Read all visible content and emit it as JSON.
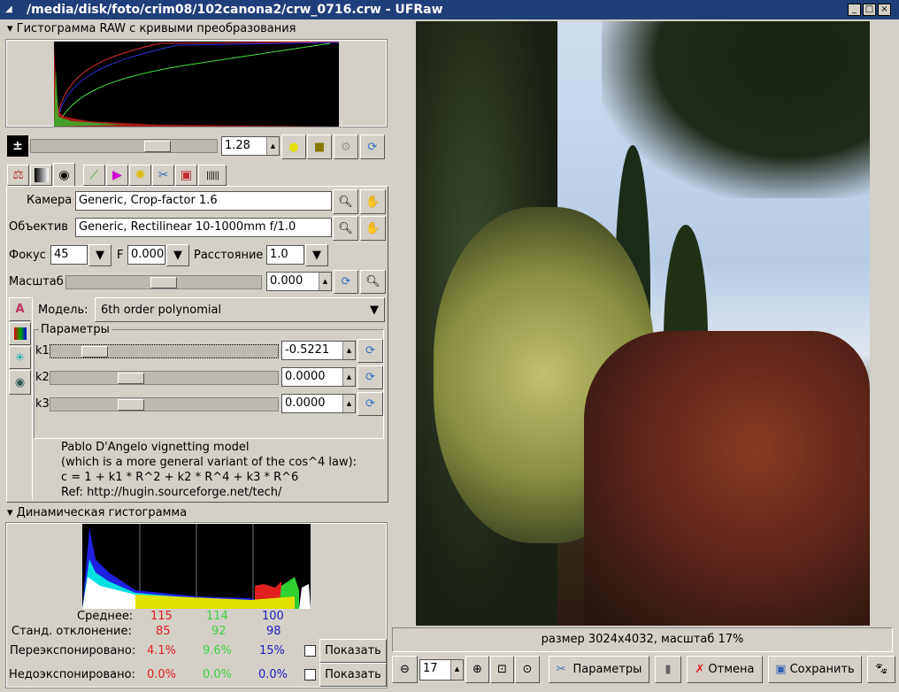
{
  "window": {
    "title": "/media/disk/foto/crim08/102canona2/crw_0716.crw - UFRaw",
    "controls": [
      "_",
      "□",
      "×"
    ]
  },
  "raw_histogram": {
    "header": "Гистограмма RAW с кривыми преобразования"
  },
  "exposure": {
    "value": "1.28",
    "slider_fraction": 0.7
  },
  "tabs": [
    "white-balance",
    "grayscale",
    "lens",
    "base-curve",
    "color-management",
    "correction",
    "crop-rotate",
    "save",
    "exif"
  ],
  "active_tab": "lens",
  "lens": {
    "camera_label": "Камера",
    "camera_value": "Generic, Crop-factor 1.6",
    "lens_label": "Объектив",
    "lens_value": "Generic, Rectilinear 10-1000mm f/1.0",
    "focal_label": "Фокус",
    "focal_value": "45",
    "f_label": "F",
    "f_value": "0.000",
    "distance_label": "Расстояние",
    "distance_value": "1.0",
    "scale_label": "Масштаб",
    "scale_value": "0.000",
    "model_label": "Модель:",
    "model_value": "6th order polynomial",
    "params_label": "Параметры",
    "params": [
      {
        "name": "k1",
        "value": "-0.5221"
      },
      {
        "name": "k2",
        "value": "0.0000"
      },
      {
        "name": "k3",
        "value": "0.0000"
      }
    ],
    "description": [
      "Pablo D'Angelo vignetting model",
      "(which is a more general variant of the cos^4 law):",
      "c = 1 + k1 * R^2 + k2 * R^4 + k3 * R^6",
      "Ref: http://hugin.sourceforge.net/tech/"
    ]
  },
  "live_histogram": {
    "header": "Динамическая гистограмма",
    "mean_label": "Среднее:",
    "mean": [
      "115",
      "114",
      "100"
    ],
    "std_label": "Станд. отклонение:",
    "std": [
      "85",
      "92",
      "98"
    ],
    "over_label": "Переэкспонировано:",
    "over": [
      "4.1%",
      "9.6%",
      "15%"
    ],
    "under_label": "Недоэкспонировано:",
    "under": [
      "0.0%",
      "0.0%",
      "0.0%"
    ],
    "show_label": "Показать"
  },
  "status": "размер 3024x4032, масштаб 17%",
  "bottom": {
    "zoom_value": "17",
    "options_label": "Параметры",
    "cancel_label": "Отмена",
    "save_label": "Сохранить"
  },
  "colors": {
    "titlebar": "#1f3f7a",
    "red": "#e02020",
    "green": "#40d040",
    "blue": "#2020c0"
  }
}
